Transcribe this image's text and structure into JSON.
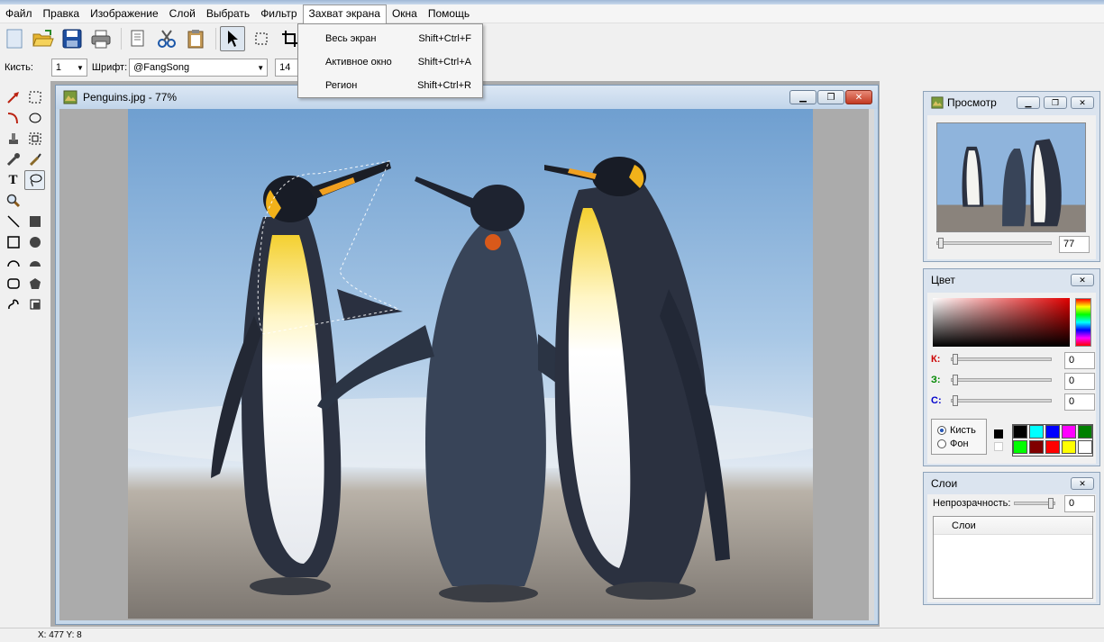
{
  "menubar": {
    "items": [
      {
        "label": "Файл"
      },
      {
        "label": "Правка"
      },
      {
        "label": "Изображение"
      },
      {
        "label": "Слой"
      },
      {
        "label": "Выбрать"
      },
      {
        "label": "Фильтр"
      },
      {
        "label": "Захват экрана",
        "open": true
      },
      {
        "label": "Окна"
      },
      {
        "label": "Помощь"
      }
    ]
  },
  "dropdown": {
    "items": [
      {
        "label": "Весь экран",
        "shortcut": "Shift+Ctrl+F"
      },
      {
        "label": "Активное окно",
        "shortcut": "Shift+Ctrl+A"
      },
      {
        "label": "Регион",
        "shortcut": "Shift+Ctrl+R"
      }
    ]
  },
  "optbar": {
    "brush_label": "Кисть:",
    "brush_value": "1",
    "font_label": "Шрифт:",
    "font_value": "@FangSong",
    "size_value": "14"
  },
  "document": {
    "title": "Penguins.jpg - 77%"
  },
  "preview_panel": {
    "title": "Просмотр",
    "zoom": "77"
  },
  "color_panel": {
    "title": "Цвет",
    "r_label": "К:",
    "g_label": "З:",
    "b_label": "С:",
    "r_value": "0",
    "g_value": "0",
    "b_value": "0",
    "brush_radio": "Кисть",
    "bg_radio": "Фон",
    "palette": [
      "#000000",
      "#00ffff",
      "#0000ff",
      "#ff00ff",
      "#008000",
      "#00ff00",
      "#800000",
      "#ff0000",
      "#ffff00",
      "#ffffff"
    ],
    "accent_hue": "#ff0000"
  },
  "layers_panel": {
    "title": "Слои",
    "opacity_label": "Непрозрачность:",
    "opacity_value": "0",
    "list_header": "Слои"
  },
  "status": {
    "coords": "X: 477 Y: 8"
  }
}
